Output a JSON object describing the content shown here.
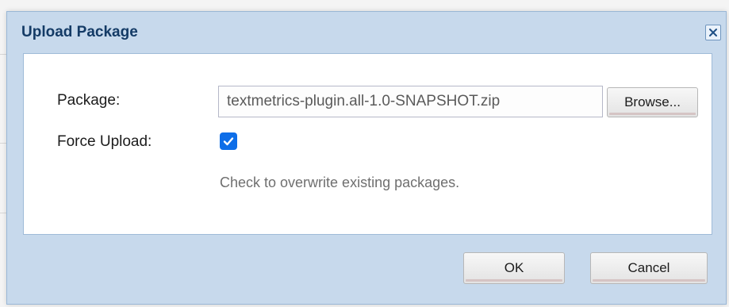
{
  "window": {
    "title": "Upload Package",
    "close_symbol": "✕"
  },
  "form": {
    "package_label": "Package:",
    "package_value": "textmetrics-plugin.all-1.0-SNAPSHOT.zip",
    "browse_label": "Browse...",
    "force_upload_label": "Force Upload:",
    "force_upload_checked": true,
    "force_upload_hint": "Check to overwrite existing packages."
  },
  "footer": {
    "ok_label": "OK",
    "cancel_label": "Cancel"
  },
  "colors": {
    "header_bg": "#c7d9ec",
    "title_text": "#143b66",
    "checkbox_accent": "#0e6ee8"
  }
}
